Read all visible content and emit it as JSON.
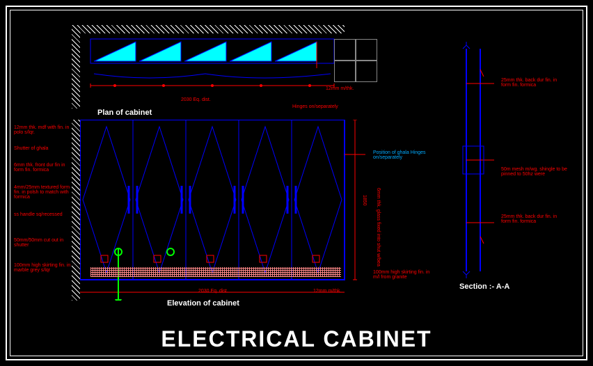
{
  "title": "ELECTRICAL CABINET",
  "plan_label": "Plan of cabinet",
  "elevation_label": "Elevation of cabinet",
  "section_label": "Section :- A-A",
  "notes_left": [
    "12mm thk. mdf with fin. in polo s/lqr.",
    "Shutter of ghala",
    "6mm thk. front dur fin in form fin. formica",
    "4mm/25mm textured form fin. in polsh to match with formica",
    "ss handle sq/recessed",
    "50mm/50mm cut out in shutter",
    "100mm high skirting fin. in marble grey s/lqr"
  ],
  "notes_right_plan": [
    "12mm m/thk.",
    "Hinges on/separately"
  ],
  "notes_right_elev": [
    "Position of ghala Hinges on/separately",
    "100mm high skirting fin. in m/l from granite",
    "12mm m/thk."
  ],
  "notes_section": [
    "25mm thk. back dur fin. in form fin. formica",
    "50m mesh m/wg. shingle to be pinned to 50hz were",
    "25mm thk. back dur fin. in form fin. formica"
  ],
  "dim_plan": "2030 Eq. dist.",
  "dim_elev": "2030 Eq. dist.",
  "dim_h": "1850",
  "vert_note": "6mm thk. glass fixed into shut w/bea"
}
